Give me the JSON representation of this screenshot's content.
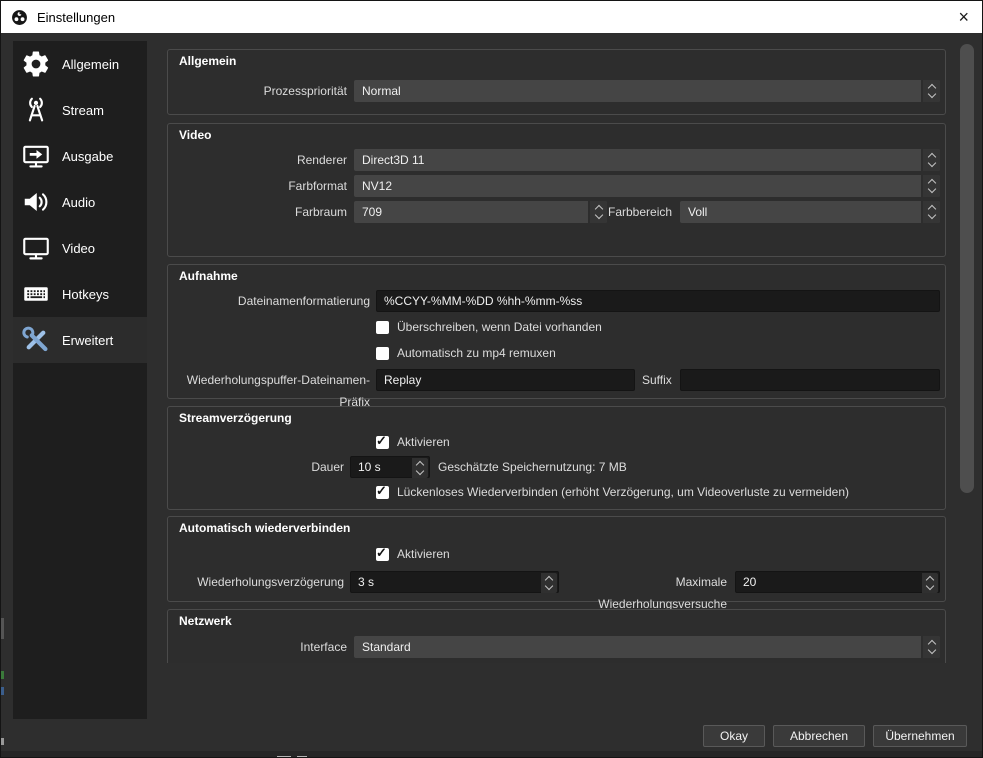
{
  "window": {
    "title": "Einstellungen",
    "close_glyph": "×"
  },
  "colors": {
    "titlebar_bg": "#ffffff",
    "dialog_bg": "#2e2e2e",
    "sidebar_bg": "#1e1e1e",
    "box_border": "#4b4b4b",
    "input_bg": "#1a1a1a",
    "combo_bg": "#454545",
    "text": "#dcdcdc",
    "button_bg": "#3a3a3a",
    "button_border": "#595959",
    "selected_icon": "#9ec1e8"
  },
  "sidebar": {
    "selected": "Erweitert",
    "items": [
      {
        "label": "Allgemein",
        "icon": "gear"
      },
      {
        "label": "Stream",
        "icon": "broadcast-antenna"
      },
      {
        "label": "Ausgabe",
        "icon": "monitor-output-arrow"
      },
      {
        "label": "Audio",
        "icon": "speaker"
      },
      {
        "label": "Video",
        "icon": "monitor"
      },
      {
        "label": "Hotkeys",
        "icon": "keyboard"
      },
      {
        "label": "Erweitert",
        "icon": "crossed-tools"
      }
    ]
  },
  "sections": {
    "allgemein": {
      "title": "Allgemein",
      "prozessprioritaet_label": "Prozesspriorität",
      "prozessprioritaet_value": "Normal"
    },
    "video": {
      "title": "Video",
      "renderer_label": "Renderer",
      "renderer_value": "Direct3D 11",
      "farbformat_label": "Farbformat",
      "farbformat_value": "NV12",
      "farbraum_label": "Farbraum",
      "farbraum_value": "709",
      "farbbereich_label": "Farbbereich",
      "farbbereich_value": "Voll"
    },
    "aufnahme": {
      "title": "Aufnahme",
      "dateiname_label": "Dateinamenformatierung",
      "dateiname_value": "%CCYY-%MM-%DD %hh-%mm-%ss",
      "ueberschreiben_label": "Überschreiben, wenn Datei vorhanden",
      "ueberschreiben_checked": false,
      "remux_label": "Automatisch zu mp4 remuxen",
      "remux_checked": false,
      "praefix_label": "Wiederholungspuffer-Dateinamen-Präfix",
      "praefix_value": "Replay",
      "suffix_label": "Suffix",
      "suffix_value": ""
    },
    "streamverzoegerung": {
      "title": "Streamverzögerung",
      "aktivieren_label": "Aktivieren",
      "aktivieren_checked": true,
      "dauer_label": "Dauer",
      "dauer_value": "10 s",
      "speicher_text": "Geschätzte Speichernutzung: 7 MB",
      "lueckenlos_label": "Lückenloses Wiederverbinden (erhöht Verzögerung, um Videoverluste zu vermeiden)",
      "lueckenlos_checked": true
    },
    "wiederverbinden": {
      "title": "Automatisch wiederverbinden",
      "aktivieren_label": "Aktivieren",
      "aktivieren_checked": true,
      "verzoegerung_label": "Wiederholungsverzögerung",
      "verzoegerung_value": "3 s",
      "versuche_label": "Maximale Wiederholungsversuche",
      "versuche_value": "20"
    },
    "netzwerk": {
      "title": "Netzwerk",
      "interface_label": "Interface",
      "interface_value": "Standard"
    }
  },
  "footer": {
    "okay": "Okay",
    "abbrechen": "Abbrechen",
    "uebernehmen": "Übernehmen"
  }
}
